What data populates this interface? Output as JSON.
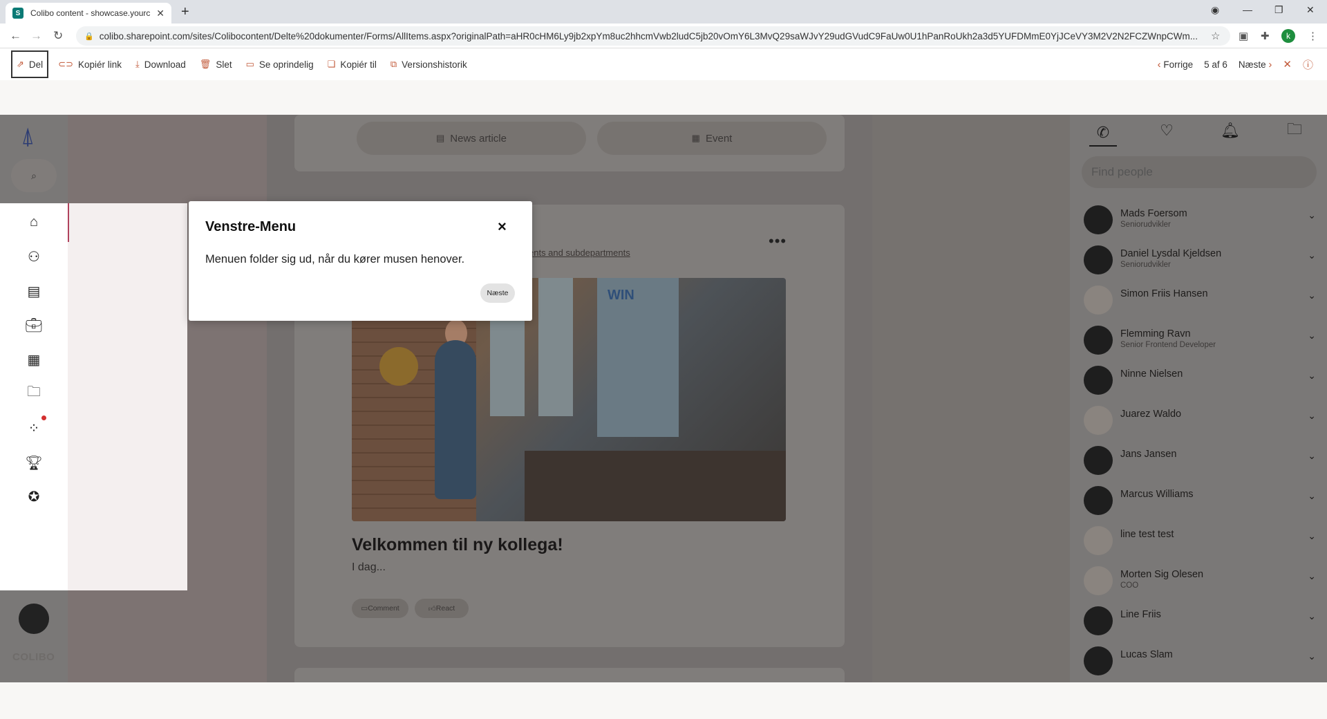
{
  "browser": {
    "tab_title": "Colibo content - showcase.yourc",
    "tab_icon": "sharepoint-icon",
    "url": "colibo.sharepoint.com/sites/Colibocontent/Delte%20dokumenter/Forms/AllItems.aspx?originalPath=aHR0cHM6Ly9jb2xpYm8uc2hhcmVwb2ludC5jb20vOmY6L3MvQ29saWJvY29udGVudC9FaUw0U1hPanRoUkh2a3d5YUFDMmE0YjJCeVY3M2V2N2FCZWnpCWm...",
    "profile_initial": "k"
  },
  "commandbar": {
    "share": "Del",
    "copy_link": "Kopiér link",
    "download": "Download",
    "delete": "Slet",
    "view_original": "Se oprindelig",
    "copy_to": "Kopiér til",
    "version_history": "Versionshistorik",
    "prev": "Forrige",
    "counter": "5 af 6",
    "next": "Næste"
  },
  "feed": {
    "tab_news": "News article",
    "tab_event": "Event",
    "link_text": "ents and subdepartments",
    "hero_sign": "WIN",
    "post_title": "Velkommen til ny kollega!",
    "post_sub": "I dag...",
    "comment": "Comment",
    "react": "React"
  },
  "popup": {
    "title": "Venstre-Menu",
    "text": "Menuen folder sig ud, når du kører musen henover.",
    "next": "Næste",
    "close": "×"
  },
  "sidebar": {
    "logo_text": "COLIBO"
  },
  "people": {
    "search_placeholder": "Find people",
    "list": [
      {
        "name": "Mads Foersom",
        "role": "Seniorudvikler"
      },
      {
        "name": "Daniel Lysdal Kjeldsen",
        "role": "Seniorudvikler"
      },
      {
        "name": "Simon Friis Hansen",
        "role": ""
      },
      {
        "name": "Flemming Ravn",
        "role": "Senior Frontend Developer"
      },
      {
        "name": "Ninne Nielsen",
        "role": ""
      },
      {
        "name": "Juarez Waldo",
        "role": ""
      },
      {
        "name": "Jans Jansen",
        "role": ""
      },
      {
        "name": "Marcus Williams",
        "role": ""
      },
      {
        "name": "line test test",
        "role": ""
      },
      {
        "name": "Morten Sig Olesen",
        "role": "COO"
      },
      {
        "name": "Line Friis",
        "role": ""
      },
      {
        "name": "Lucas Slam",
        "role": ""
      }
    ]
  },
  "colors": {
    "accent": "#c25a3a",
    "brand": "#2c3c73",
    "nav_edge": "#b0425c",
    "notification": "#d32f2f"
  }
}
